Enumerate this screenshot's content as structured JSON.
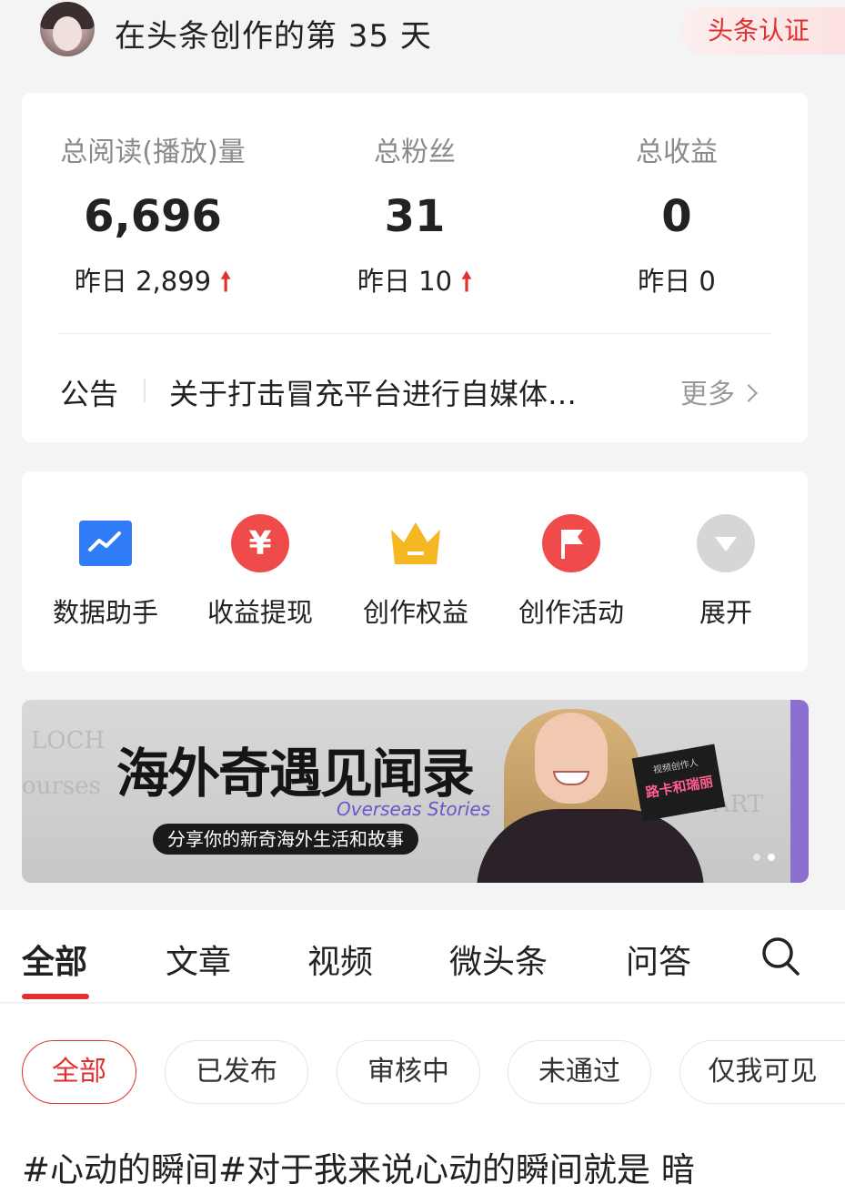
{
  "header": {
    "title": "在头条创作的第 35 天",
    "cert_label": "头条认证"
  },
  "stats": [
    {
      "label": "总阅读(播放)量",
      "value": "6,696",
      "yesterday": "昨日 2,899",
      "trend": "up"
    },
    {
      "label": "总粉丝",
      "value": "31",
      "yesterday": "昨日 10",
      "trend": "up"
    },
    {
      "label": "总收益",
      "value": "0",
      "yesterday": "昨日 0",
      "trend": "none"
    }
  ],
  "notice": {
    "label": "公告",
    "text": "关于打击冒充平台进行自媒体…",
    "more_label": "更多"
  },
  "tools": [
    {
      "label": "数据助手",
      "icon": "chart-icon",
      "color": "#2f7cf6"
    },
    {
      "label": "收益提现",
      "icon": "yuan-icon",
      "color": "#f04b4b"
    },
    {
      "label": "创作权益",
      "icon": "crown-icon",
      "color": "#f5b822"
    },
    {
      "label": "创作活动",
      "icon": "flag-icon",
      "color": "#f04b4b"
    },
    {
      "label": "展开",
      "icon": "expand-icon",
      "color": "#d6d6d6"
    }
  ],
  "banner": {
    "title": "海外奇遇见闻录",
    "subtitle_en": "Overseas Stories",
    "pill_text": "分享你的新奇海外生活和故事",
    "tag_small": "视频创作人",
    "tag_name": "路卡和瑞丽"
  },
  "tabs": [
    "全部",
    "文章",
    "视频",
    "微头条",
    "问答"
  ],
  "filters": [
    "全部",
    "已发布",
    "审核中",
    "未通过",
    "仅我可见"
  ],
  "post_preview": "#心动的瞬间#对于我来说心动的瞬间就是 暗",
  "colors": {
    "accent": "#e0302f",
    "banner_purple": "#8b6fd1"
  }
}
